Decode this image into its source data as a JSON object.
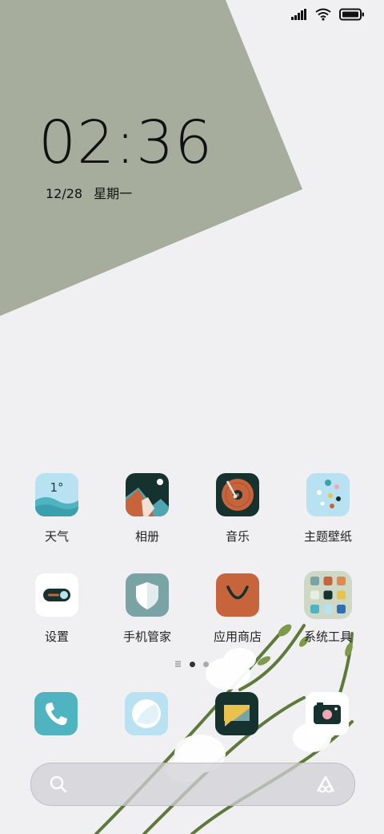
{
  "status_bar": {
    "signal_icon": "signal-icon",
    "wifi_icon": "wifi-icon",
    "battery_icon": "battery-icon"
  },
  "clock": {
    "time": "02:36",
    "date": "12/28",
    "weekday": "星期一"
  },
  "apps": [
    {
      "label": "天气",
      "icon": "weather-icon",
      "temp": "1°"
    },
    {
      "label": "相册",
      "icon": "gallery-icon"
    },
    {
      "label": "音乐",
      "icon": "music-icon"
    },
    {
      "label": "主题壁纸",
      "icon": "themes-icon"
    },
    {
      "label": "设置",
      "icon": "settings-icon"
    },
    {
      "label": "手机管家",
      "icon": "security-icon"
    },
    {
      "label": "应用商店",
      "icon": "app-store-icon"
    },
    {
      "label": "系统工具",
      "icon": "folder-icon"
    }
  ],
  "dock": [
    {
      "icon": "phone-icon"
    },
    {
      "icon": "browser-icon"
    },
    {
      "icon": "messages-icon"
    },
    {
      "icon": "camera-icon"
    }
  ],
  "search_bar": {
    "search_icon": "search-icon",
    "assistant_icon": "assistant-icon"
  },
  "colors": {
    "wallpaper_shape": "#a7ad9c",
    "background": "#f0f0f2"
  }
}
